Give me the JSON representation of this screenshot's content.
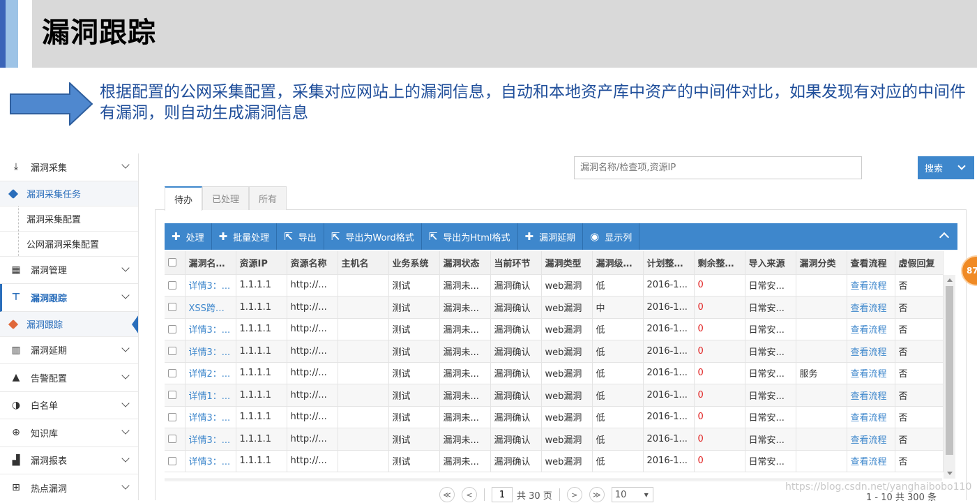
{
  "slide": {
    "title": "漏洞跟踪",
    "description": "根据配置的公网采集配置，采集对应网站上的漏洞信息，自动和本地资产库中资产的中间件对比，如果发现有对应的中间件有漏洞，则自动生成漏洞信息"
  },
  "sidebar": {
    "groups": [
      {
        "label": "漏洞采集",
        "icon": "download-icon"
      },
      {
        "label": "漏洞管理",
        "icon": "list-icon"
      },
      {
        "label": "漏洞跟踪",
        "icon": "pin-icon"
      },
      {
        "label": "漏洞延期",
        "icon": "film-icon"
      },
      {
        "label": "告警配置",
        "icon": "bell-icon"
      },
      {
        "label": "白名单",
        "icon": "contrast-icon"
      },
      {
        "label": "知识库",
        "icon": "lifebuoy-icon"
      },
      {
        "label": "漏洞报表",
        "icon": "bar-chart-icon"
      },
      {
        "label": "热点漏洞",
        "icon": "grid-icon"
      }
    ],
    "collect_sub": [
      "漏洞采集任务",
      "漏洞采集配置",
      "公网漏洞采集配置"
    ],
    "track_sub": [
      "漏洞跟踪"
    ]
  },
  "search": {
    "placeholder": "漏洞名称/检查项,资源IP",
    "button": "搜索"
  },
  "tabs": [
    "待办",
    "已处理",
    "所有"
  ],
  "toolbar": [
    {
      "icon": "plus-icon",
      "glyph": "✚",
      "label": "处理"
    },
    {
      "icon": "plus-icon",
      "glyph": "✚",
      "label": "批量处理"
    },
    {
      "icon": "export-icon",
      "glyph": "⇱",
      "label": "导出"
    },
    {
      "icon": "export-icon",
      "glyph": "⇱",
      "label": "导出为Word格式"
    },
    {
      "icon": "export-icon",
      "glyph": "⇱",
      "label": "导出为Html格式"
    },
    {
      "icon": "plus-icon",
      "glyph": "✚",
      "label": "漏洞延期"
    },
    {
      "icon": "settings-icon",
      "glyph": "◉",
      "label": "显示列"
    }
  ],
  "table": {
    "columns": [
      "漏洞名称/检",
      "资源IP",
      "资源名称",
      "主机名",
      "业务系统",
      "漏洞状态",
      "当前环节",
      "漏洞类型",
      "漏洞级别/检",
      "计划整改时",
      "剩余整改天",
      "导入来源",
      "漏洞分类",
      "查看流程",
      "虚假回复"
    ],
    "rows": [
      [
        "详情3：...",
        "1.1.1.1",
        "http://...",
        "",
        "测试",
        "漏洞未...",
        "漏洞确认",
        "web漏洞",
        "低",
        "2016-1...",
        "0",
        "日常安...",
        "",
        "查看流程",
        "否"
      ],
      [
        "XSS跨站...",
        "1.1.1.1",
        "http://...",
        "",
        "测试",
        "漏洞未...",
        "漏洞确认",
        "web漏洞",
        "中",
        "2016-1...",
        "0",
        "日常安...",
        "",
        "查看流程",
        "否"
      ],
      [
        "详情3：...",
        "1.1.1.1",
        "http://...",
        "",
        "测试",
        "漏洞未...",
        "漏洞确认",
        "web漏洞",
        "低",
        "2016-1...",
        "0",
        "日常安...",
        "",
        "查看流程",
        "否"
      ],
      [
        "详情3：...",
        "1.1.1.1",
        "http://...",
        "",
        "测试",
        "漏洞未...",
        "漏洞确认",
        "web漏洞",
        "低",
        "2016-1...",
        "0",
        "日常安...",
        "",
        "查看流程",
        "否"
      ],
      [
        "详情2：...",
        "1.1.1.1",
        "http://...",
        "",
        "测试",
        "漏洞未...",
        "漏洞确认",
        "web漏洞",
        "低",
        "2016-1...",
        "0",
        "日常安...",
        "服务",
        "查看流程",
        "否"
      ],
      [
        "详情1：...",
        "1.1.1.1",
        "http://...",
        "",
        "测试",
        "漏洞未...",
        "漏洞确认",
        "web漏洞",
        "低",
        "2016-1...",
        "0",
        "日常安...",
        "",
        "查看流程",
        "否"
      ],
      [
        "详情3：...",
        "1.1.1.1",
        "http://...",
        "",
        "测试",
        "漏洞未...",
        "漏洞确认",
        "web漏洞",
        "低",
        "2016-1...",
        "0",
        "日常安...",
        "",
        "查看流程",
        "否"
      ],
      [
        "详情3：...",
        "1.1.1.1",
        "http://...",
        "",
        "测试",
        "漏洞未...",
        "漏洞确认",
        "web漏洞",
        "低",
        "2016-1...",
        "0",
        "日常安...",
        "",
        "查看流程",
        "否"
      ],
      [
        "详情3：...",
        "1.1.1.1",
        "http://...",
        "",
        "测试",
        "漏洞未...",
        "漏洞确认",
        "web漏洞",
        "低",
        "2016-1...",
        "0",
        "日常安...",
        "",
        "查看流程",
        "否"
      ]
    ]
  },
  "pager": {
    "first": "≪",
    "prev": "<",
    "page": "1",
    "total_pages": "共 30 页",
    "next": ">",
    "last": "≫",
    "page_size": "10",
    "range": "1 - 10   共 300 条"
  },
  "badge": "87",
  "watermark": "https://blog.csdn.net/yanghaibobo110",
  "colors": {
    "accent": "#3e87cc",
    "link": "#3e87cc",
    "alert": "#e02020",
    "title_text": "#1f4e9a"
  }
}
